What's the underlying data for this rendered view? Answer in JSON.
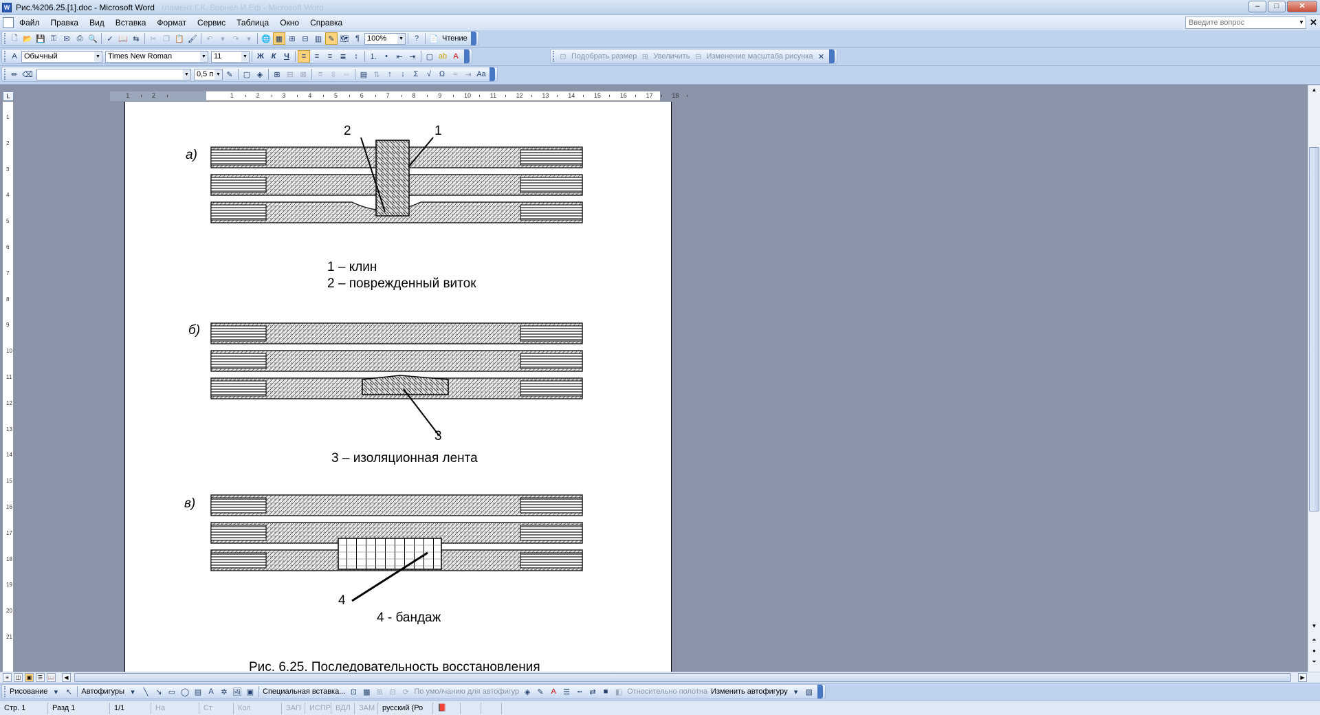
{
  "window": {
    "title": "Рис.%206.25.[1].doc - Microsoft Word",
    "ghost_title": "гламент Г.К. Ворнел И.Еф - Microsoft Word"
  },
  "menu": [
    "Файл",
    "Правка",
    "Вид",
    "Вставка",
    "Формат",
    "Сервис",
    "Таблица",
    "Окно",
    "Справка"
  ],
  "help": {
    "placeholder": "Введите вопрос"
  },
  "standard": {
    "zoom": "100%",
    "reading": "Чтение"
  },
  "formatting": {
    "style": "Обычный",
    "font": "Times New Roman",
    "size": "11",
    "bold": "Ж",
    "italic": "К",
    "underline": "Ч"
  },
  "picture": {
    "fit": "Подобрать размер",
    "zoom_in": "Увеличить",
    "scale": "Изменение масштаба рисунка"
  },
  "tables": {
    "line_width": "0,5 п"
  },
  "ruler": {
    "h_labels": [
      "2",
      "1",
      "1",
      "2",
      "3",
      "4",
      "5",
      "6",
      "7",
      "8",
      "9",
      "10",
      "11",
      "12",
      "13",
      "14",
      "15",
      "16",
      "17",
      "18"
    ],
    "v_labels": [
      "1",
      "2",
      "3",
      "4",
      "5",
      "6",
      "7",
      "8",
      "9",
      "10",
      "11",
      "12",
      "13",
      "14",
      "15",
      "16",
      "17",
      "18",
      "19",
      "20",
      "21"
    ]
  },
  "figure": {
    "a": {
      "letter": "а)",
      "n1": "1",
      "n2": "2",
      "cap1": "1 – клин",
      "cap2": "2 – поврежденный виток"
    },
    "b": {
      "letter": "б)",
      "n3": "3",
      "cap": "3 – изоляционная лента"
    },
    "c": {
      "letter": "в)",
      "n4": "4",
      "cap": "4 - бандаж"
    },
    "bottom": "Рис. 6.25. Последовательность восстановления"
  },
  "drawing": {
    "draw": "Рисование",
    "autoshapes": "Автофигуры",
    "paste_special": "Специальная вставка...",
    "default": "По умолчанию для автофигур",
    "relative": "Относительно полотна",
    "change": "Изменить автофигуру"
  },
  "status": {
    "page": "Стр. 1",
    "section": "Разд 1",
    "pages": "1/1",
    "at": "На",
    "ln": "Ст",
    "col": "Кол",
    "rec": "ЗАП",
    "trk": "ИСПР",
    "ext": "ВДЛ",
    "ovr": "ЗАМ",
    "lang": "русский (Ро"
  }
}
